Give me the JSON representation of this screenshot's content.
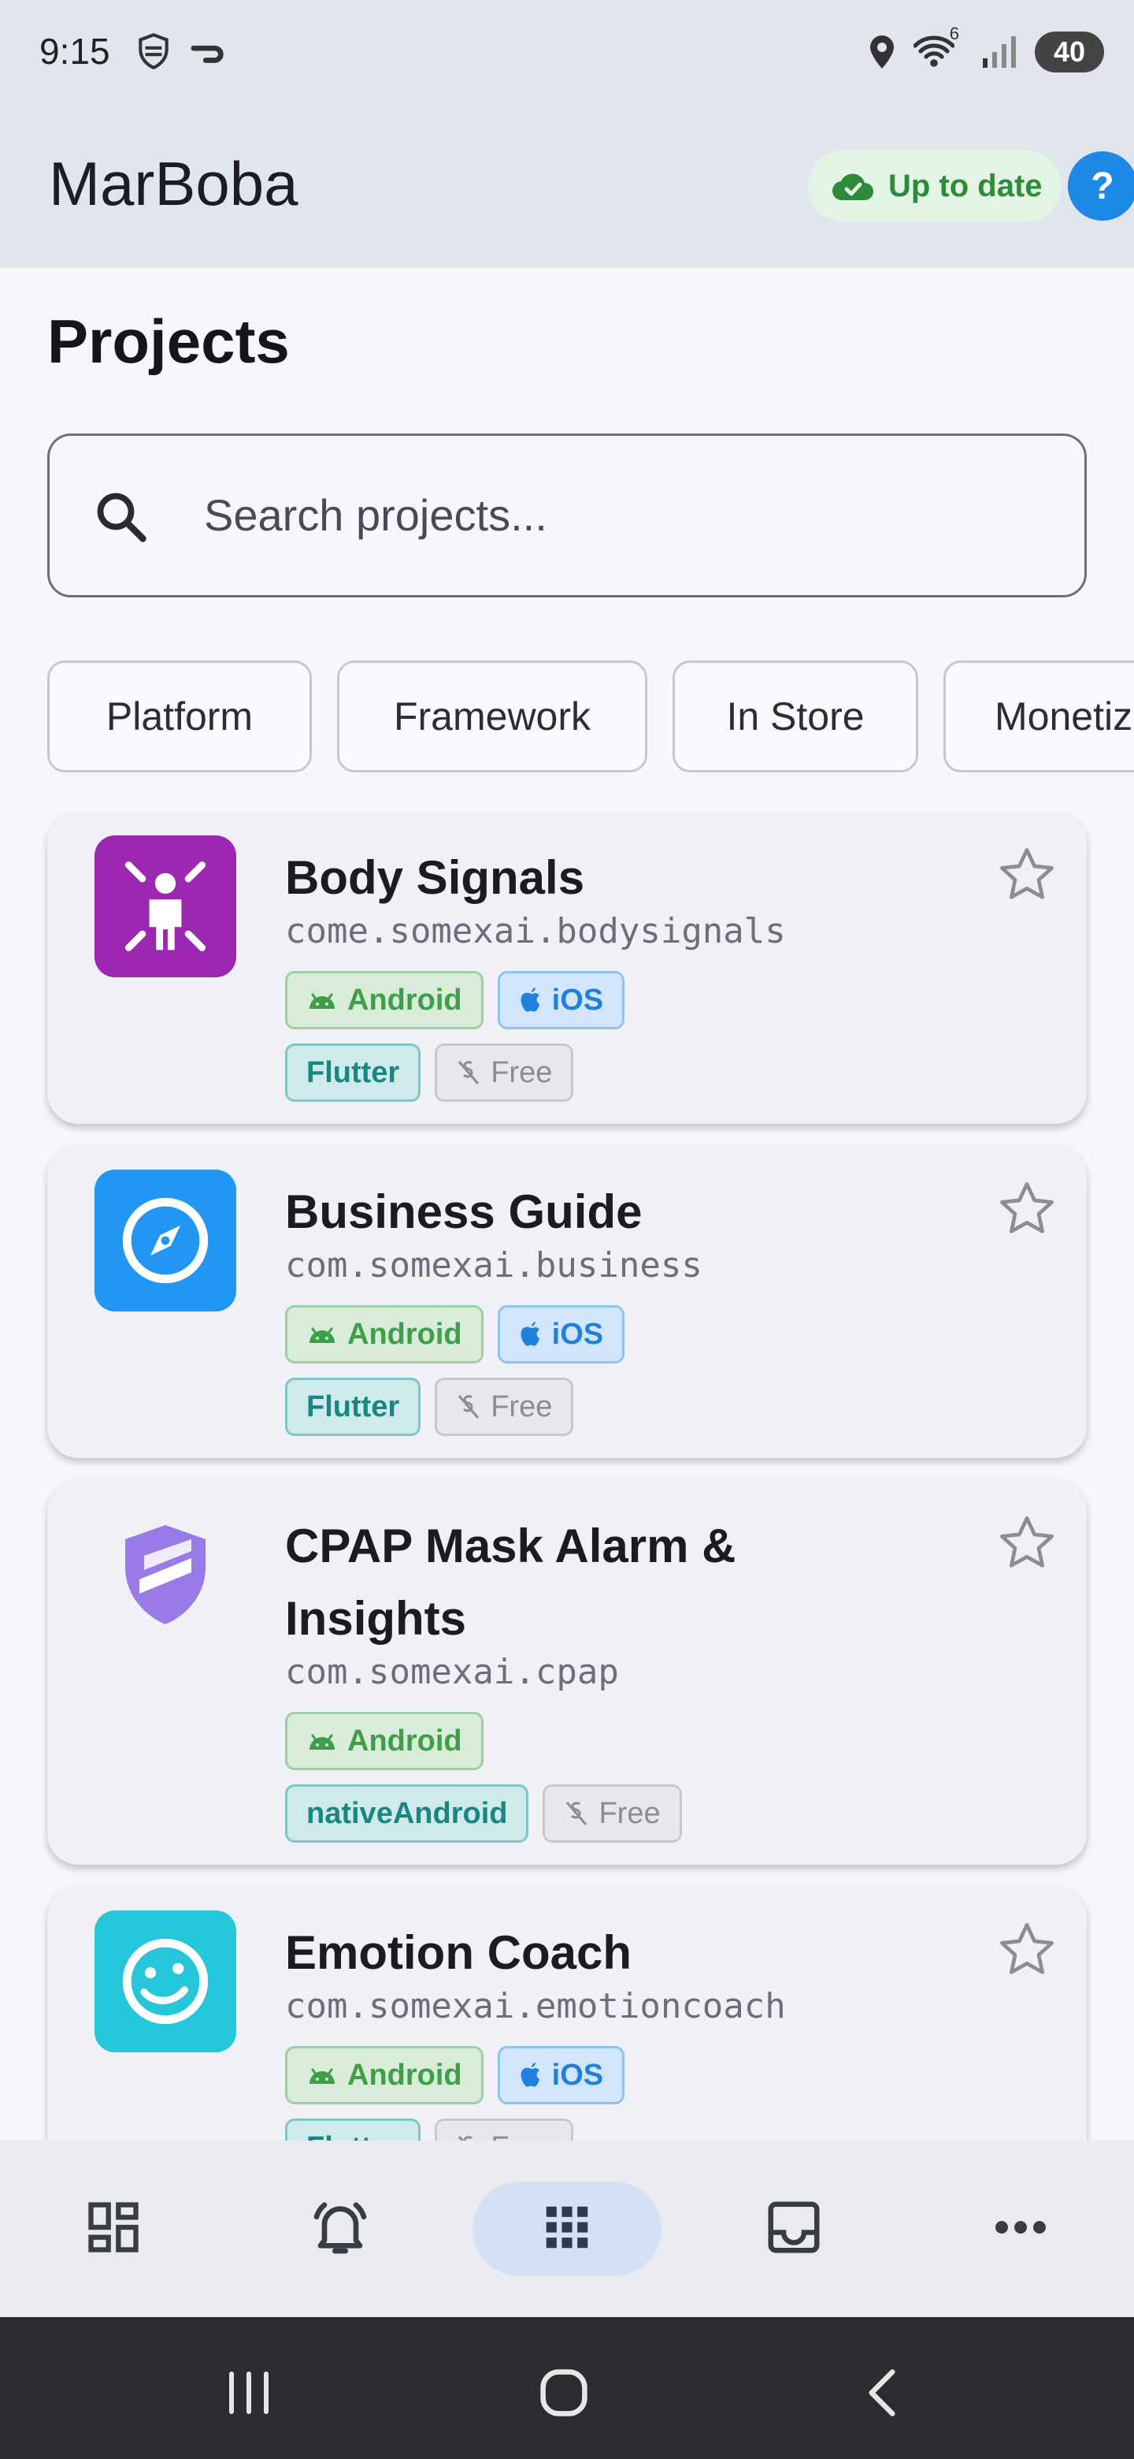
{
  "status": {
    "time": "9:15",
    "battery": "40",
    "wifi_sup": "6"
  },
  "appbar": {
    "title": "MarBoba",
    "sync_status": "Up to date",
    "help_label": "?"
  },
  "page": {
    "title": "Projects"
  },
  "search": {
    "placeholder": "Search projects..."
  },
  "filters": [
    "Platform",
    "Framework",
    "In Store",
    "Monetiz"
  ],
  "projects": [
    {
      "name": "Body Signals",
      "package": "come.somexai.bodysignals",
      "platforms": [
        "Android",
        "iOS"
      ],
      "framework": "Flutter",
      "monetization": "Free",
      "icon": "person-rays-icon",
      "icon_color": "#9c27b0"
    },
    {
      "name": "Business Guide",
      "package": "com.somexai.business",
      "platforms": [
        "Android",
        "iOS"
      ],
      "framework": "Flutter",
      "monetization": "Free",
      "icon": "compass-icon",
      "icon_color": "#2196f3"
    },
    {
      "name": "CPAP Mask Alarm &",
      "name2": "Insights",
      "package": "com.somexai.cpap",
      "platforms": [
        "Android"
      ],
      "framework": "nativeAndroid",
      "monetization": "Free",
      "icon": "shield-icon",
      "icon_color": "#9a7ae6"
    },
    {
      "name": "Emotion Coach",
      "package": "com.somexai.emotioncoach",
      "platforms": [
        "Android",
        "iOS"
      ],
      "framework": "Flutter",
      "monetization": "Free",
      "icon": "smiley-icon",
      "icon_color": "#26c6da"
    }
  ],
  "bottom_nav": [
    "dashboard-icon",
    "alarm-bell-icon",
    "apps-grid-icon",
    "inbox-icon",
    "more-icon"
  ],
  "colors": {
    "accent": "#1e88e5",
    "android": "#3e9f48",
    "ios": "#1f80de",
    "flutter": "#178781"
  }
}
